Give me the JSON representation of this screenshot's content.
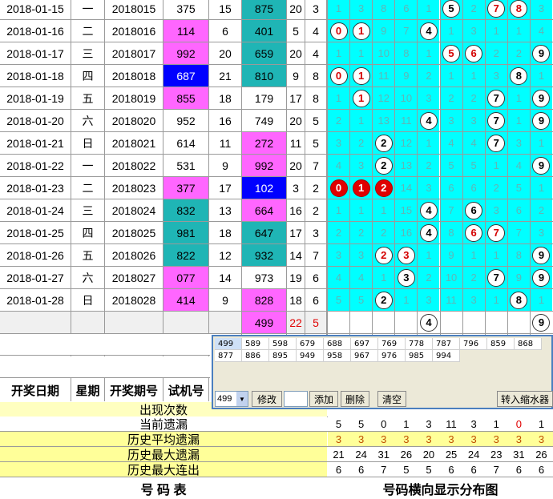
{
  "rows": [
    {
      "date": "2018-01-15",
      "day": "一",
      "issue": "2018015",
      "test": "375",
      "n1": "15",
      "prize": "875",
      "n2": "20",
      "n3": "3",
      "dist": [
        "1",
        "3",
        "8",
        "6",
        "1",
        "5",
        "2",
        "7",
        "8",
        "3"
      ]
    },
    {
      "date": "2018-01-16",
      "day": "二",
      "issue": "2018016",
      "test": "114",
      "n1": "6",
      "prize": "401",
      "n2": "5",
      "n3": "4",
      "dist": [
        "0",
        "1",
        "9",
        "7",
        "4",
        "1",
        "3",
        "1",
        "1",
        "4"
      ]
    },
    {
      "date": "2018-01-17",
      "day": "三",
      "issue": "2018017",
      "test": "992",
      "n1": "20",
      "prize": "659",
      "n2": "20",
      "n3": "4",
      "dist": [
        "1",
        "1",
        "10",
        "8",
        "1",
        "5",
        "6",
        "2",
        "2",
        "9"
      ]
    },
    {
      "date": "2018-01-18",
      "day": "四",
      "issue": "2018018",
      "test": "687",
      "n1": "21",
      "prize": "810",
      "n2": "9",
      "n3": "8",
      "dist": [
        "0",
        "1",
        "11",
        "9",
        "2",
        "1",
        "1",
        "3",
        "8",
        "1"
      ]
    },
    {
      "date": "2018-01-19",
      "day": "五",
      "issue": "2018019",
      "test": "855",
      "n1": "18",
      "prize": "179",
      "n2": "17",
      "n3": "8",
      "dist": [
        "1",
        "1",
        "12",
        "10",
        "3",
        "2",
        "2",
        "7",
        "1",
        "9"
      ]
    },
    {
      "date": "2018-01-20",
      "day": "六",
      "issue": "2018020",
      "test": "952",
      "n1": "16",
      "prize": "749",
      "n2": "20",
      "n3": "5",
      "dist": [
        "2",
        "1",
        "13",
        "11",
        "4",
        "3",
        "3",
        "7",
        "1",
        "9"
      ]
    },
    {
      "date": "2018-01-21",
      "day": "日",
      "issue": "2018021",
      "test": "614",
      "n1": "11",
      "prize": "272",
      "n2": "11",
      "n3": "5",
      "dist": [
        "3",
        "2",
        "2",
        "12",
        "1",
        "4",
        "4",
        "7",
        "3",
        "1"
      ]
    },
    {
      "date": "2018-01-22",
      "day": "一",
      "issue": "2018022",
      "test": "531",
      "n1": "9",
      "prize": "992",
      "n2": "20",
      "n3": "7",
      "dist": [
        "4",
        "3",
        "2",
        "13",
        "2",
        "5",
        "5",
        "1",
        "4",
        "9"
      ]
    },
    {
      "date": "2018-01-23",
      "day": "二",
      "issue": "2018023",
      "test": "377",
      "n1": "17",
      "prize": "102",
      "n2": "3",
      "n3": "2",
      "dist": [
        "0",
        "1",
        "2",
        "14",
        "3",
        "6",
        "6",
        "2",
        "5",
        "1"
      ]
    },
    {
      "date": "2018-01-24",
      "day": "三",
      "issue": "2018024",
      "test": "832",
      "n1": "13",
      "prize": "664",
      "n2": "16",
      "n3": "2",
      "dist": [
        "1",
        "1",
        "1",
        "15",
        "4",
        "7",
        "6",
        "3",
        "6",
        "2"
      ]
    },
    {
      "date": "2018-01-25",
      "day": "四",
      "issue": "2018025",
      "test": "981",
      "n1": "18",
      "prize": "647",
      "n2": "17",
      "n3": "3",
      "dist": [
        "2",
        "2",
        "2",
        "16",
        "4",
        "8",
        "6",
        "7",
        "7",
        "3"
      ]
    },
    {
      "date": "2018-01-26",
      "day": "五",
      "issue": "2018026",
      "test": "822",
      "n1": "12",
      "prize": "932",
      "n2": "14",
      "n3": "7",
      "dist": [
        "3",
        "3",
        "2",
        "3",
        "1",
        "9",
        "1",
        "1",
        "8",
        "9"
      ]
    },
    {
      "date": "2018-01-27",
      "day": "六",
      "issue": "2018027",
      "test": "077",
      "n1": "14",
      "prize": "973",
      "n2": "19",
      "n3": "6",
      "dist": [
        "4",
        "4",
        "1",
        "3",
        "2",
        "10",
        "2",
        "7",
        "9",
        "9"
      ]
    },
    {
      "date": "2018-01-28",
      "day": "日",
      "issue": "2018028",
      "test": "414",
      "n1": "9",
      "prize": "828",
      "n2": "18",
      "n3": "6",
      "dist": [
        "5",
        "5",
        "2",
        "1",
        "3",
        "11",
        "3",
        "1",
        "8",
        "1"
      ]
    }
  ],
  "pending": {
    "prize": "499",
    "n2": "22",
    "n3": "5",
    "dist": [
      "",
      "",
      "",
      "",
      "4",
      "",
      "",
      "",
      "",
      "9"
    ]
  },
  "headers": {
    "date": "开奖日期",
    "day": "星期",
    "issue": "开奖期号",
    "test": "试机号"
  },
  "palette": {
    "row1": [
      "499",
      "589",
      "598",
      "679",
      "688",
      "697",
      "769",
      "778",
      "787",
      "796",
      "859",
      "868"
    ],
    "row2": [
      "877",
      "886",
      "895",
      "949",
      "958",
      "967",
      "976",
      "985",
      "994"
    ],
    "select_value": "499",
    "btn_modify": "修改",
    "btn_add": "添加",
    "btn_delete": "删除",
    "btn_clear": "清空",
    "btn_shrink": "转入缩水器"
  },
  "summary": {
    "appear_label": "出现次数",
    "cur_label": "当前遗漏",
    "cur": [
      "5",
      "5",
      "0",
      "1",
      "3",
      "11",
      "3",
      "1",
      "0",
      "1"
    ],
    "avg_label": "历史平均遗漏",
    "avg": [
      "3",
      "3",
      "3",
      "3",
      "3",
      "3",
      "3",
      "3",
      "3",
      "3"
    ],
    "max_label": "历史最大遗漏",
    "max": [
      "21",
      "24",
      "31",
      "26",
      "20",
      "25",
      "24",
      "23",
      "31",
      "26"
    ],
    "cont_label": "历史最大连出",
    "cont": [
      "6",
      "6",
      "7",
      "5",
      "5",
      "6",
      "6",
      "7",
      "6",
      "6"
    ]
  },
  "footer": {
    "left": "号 码 表",
    "right": "号码横向显示分布图"
  },
  "colors": {
    "cyan": "#00ffff",
    "teal": "#1fb5b5",
    "magenta": "#ff66ff",
    "blue": "#0000ff",
    "yellow": "#ffff99",
    "grid": "#9a9a9a"
  }
}
